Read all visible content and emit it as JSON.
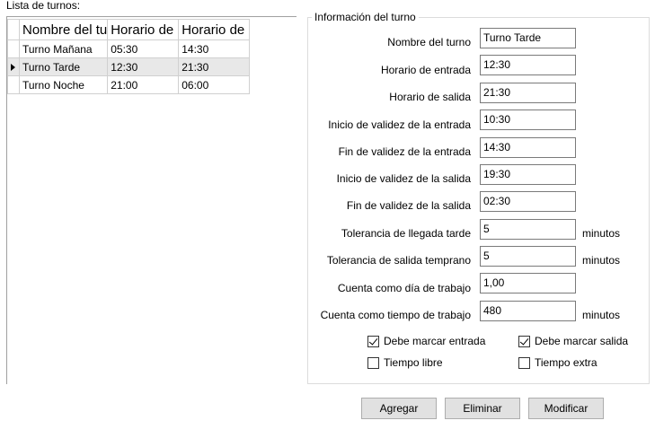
{
  "list": {
    "label": "Lista de turnos:",
    "columns": [
      "Nombre del tu",
      "Horario de",
      "Horario de"
    ],
    "rows": [
      {
        "name": "Turno Mañana",
        "start": "05:30",
        "end": "14:30",
        "selected": false
      },
      {
        "name": "Turno Tarde",
        "start": "12:30",
        "end": "21:30",
        "selected": true
      },
      {
        "name": "Turno Noche",
        "start": "21:00",
        "end": "06:00",
        "selected": false
      }
    ]
  },
  "form": {
    "title": "Información del turno",
    "fields": [
      {
        "label": "Nombre del turno",
        "value": "Turno Tarde",
        "unit": ""
      },
      {
        "label": "Horario de entrada",
        "value": "12:30",
        "unit": ""
      },
      {
        "label": "Horario de salida",
        "value": "21:30",
        "unit": ""
      },
      {
        "label": "Inicio de validez de la entrada",
        "value": "10:30",
        "unit": ""
      },
      {
        "label": "Fin de validez de la entrada",
        "value": "14:30",
        "unit": ""
      },
      {
        "label": "Inicio de validez de la salida",
        "value": "19:30",
        "unit": ""
      },
      {
        "label": "Fin de validez de la salida",
        "value": "02:30",
        "unit": ""
      },
      {
        "label": "Tolerancia de llegada tarde",
        "value": "5",
        "unit": "minutos"
      },
      {
        "label": "Tolerancia de salida temprano",
        "value": "5",
        "unit": "minutos"
      },
      {
        "label": "Cuenta como día de trabajo",
        "value": "1,00",
        "unit": ""
      },
      {
        "label": "Cuenta como tiempo de trabajo",
        "value": "480",
        "unit": "minutos"
      }
    ],
    "checkboxes": {
      "debe_marcar_entrada": {
        "label": "Debe marcar entrada",
        "checked": true
      },
      "debe_marcar_salida": {
        "label": "Debe marcar salida",
        "checked": true
      },
      "tiempo_libre": {
        "label": "Tiempo libre",
        "checked": false
      },
      "tiempo_extra": {
        "label": "Tiempo extra",
        "checked": false
      }
    }
  },
  "buttons": {
    "agregar": "Agregar",
    "eliminar": "Eliminar",
    "modificar": "Modificar"
  }
}
